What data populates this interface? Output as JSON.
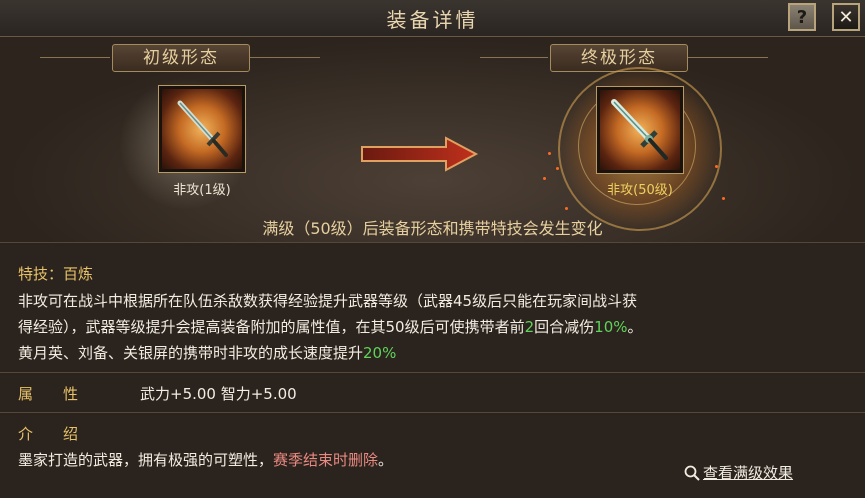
{
  "header": {
    "title": "装备详情",
    "help_label": "?",
    "close_label": "✕"
  },
  "stage": {
    "initial_label": "初级形态",
    "final_label": "终极形态",
    "initial_item": "非攻(1级)",
    "final_item": "非攻(50级)",
    "note": "满级（50级）后装备形态和携带特技会发生变化"
  },
  "skill": {
    "label": "特技：百炼",
    "line1": "非攻可在战斗中根据所在队伍杀敌数获得经验提升武器等级（武器45级后只能在玩家间战斗获",
    "line2_pre": "得经验），武器等级提升会提高装备附加的属性值，在其50级后可使携带者前",
    "line2_rounds": "2",
    "line2_mid": "回合减伤",
    "line2_pct": "10%",
    "line2_end": "。",
    "line3_pre": "黄月英、刘备、关银屏的携带时非攻的成长速度提升",
    "line3_pct": "20%"
  },
  "attributes": {
    "label": "属　　性",
    "value": "武力+5.00  智力+5.00"
  },
  "intro": {
    "label": "介　　绍",
    "text": "墨家打造的武器，拥有极强的可塑性，",
    "warning": "赛季结束时删除",
    "end": "。"
  },
  "footer": {
    "link_label": "查看满级效果"
  },
  "colors": {
    "gold": "#e8c268",
    "green": "#5fd35b",
    "red": "#e88a82",
    "final_name": "#f0d060"
  }
}
